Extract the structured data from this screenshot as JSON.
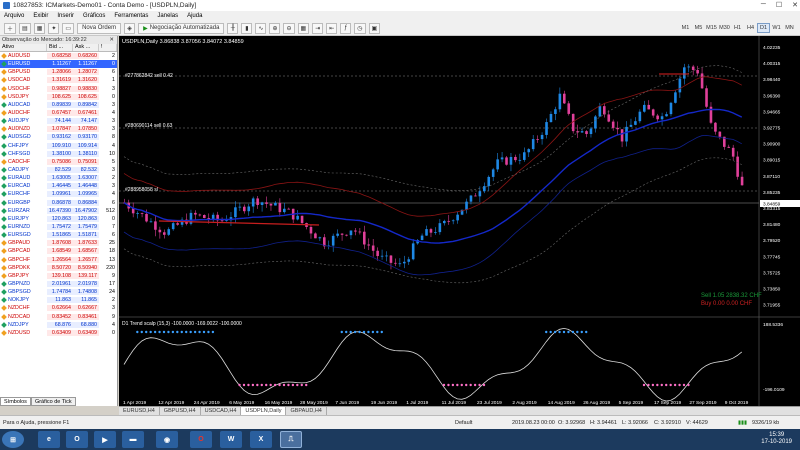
{
  "window": {
    "title": "10827853: ICMarkets-Demo01 - Conta Demo - [USDPLN,Daily]",
    "min": "─",
    "max": "☐",
    "close": "✕"
  },
  "menu": [
    "Arquivo",
    "Exibir",
    "Inserir",
    "Gráficos",
    "Ferramentas",
    "Janelas",
    "Ajuda"
  ],
  "toolbar": {
    "new_order": "Nova Ordem",
    "auto_trading": "Negociação Automatizada",
    "timeframes": [
      "M1",
      "M5",
      "M15",
      "M30",
      "H1",
      "H4",
      "D1",
      "W1",
      "MN"
    ],
    "active_timeframe": "D1"
  },
  "market_watch": {
    "title": "Observação do Mercado: 16:39:22",
    "columns": [
      "Ativo",
      "Bid ...",
      "Ask ...",
      "!"
    ],
    "rows": [
      {
        "s": "AUDUSD",
        "b": "0.68258",
        "a": "0.68260",
        "sp": "2",
        "d": "dn"
      },
      {
        "s": "EURUSD",
        "b": "1.11267",
        "a": "1.11267",
        "sp": "0",
        "d": "hl"
      },
      {
        "s": "GBPUSD",
        "b": "1.28066",
        "a": "1.28072",
        "sp": "6",
        "d": "dn"
      },
      {
        "s": "USDCAD",
        "b": "1.31619",
        "a": "1.31620",
        "sp": "1",
        "d": "dn"
      },
      {
        "s": "USDCHF",
        "b": "0.98827",
        "a": "0.98830",
        "sp": "3",
        "d": "dn"
      },
      {
        "s": "USDJPY",
        "b": "108.625",
        "a": "108.625",
        "sp": "0",
        "d": "dn"
      },
      {
        "s": "AUDCAD",
        "b": "0.89839",
        "a": "0.89842",
        "sp": "3",
        "d": "up"
      },
      {
        "s": "AUDCHF",
        "b": "0.67457",
        "a": "0.67461",
        "sp": "4",
        "d": "dn"
      },
      {
        "s": "AUDJPY",
        "b": "74.144",
        "a": "74.147",
        "sp": "3",
        "d": "up"
      },
      {
        "s": "AUDNZD",
        "b": "1.07847",
        "a": "1.07850",
        "sp": "3",
        "d": "dn"
      },
      {
        "s": "AUDSGD",
        "b": "0.93162",
        "a": "0.93170",
        "sp": "8",
        "d": "up"
      },
      {
        "s": "CHFJPY",
        "b": "109.910",
        "a": "109.914",
        "sp": "4",
        "d": "up"
      },
      {
        "s": "CHFSGD",
        "b": "1.38100",
        "a": "1.38110",
        "sp": "10",
        "d": "up"
      },
      {
        "s": "CADCHF",
        "b": "0.75086",
        "a": "0.75091",
        "sp": "5",
        "d": "dn"
      },
      {
        "s": "CADJPY",
        "b": "82.529",
        "a": "82.532",
        "sp": "3",
        "d": "up"
      },
      {
        "s": "EURAUD",
        "b": "1.63005",
        "a": "1.63007",
        "sp": "2",
        "d": "up"
      },
      {
        "s": "EURCAD",
        "b": "1.46445",
        "a": "1.46448",
        "sp": "3",
        "d": "up"
      },
      {
        "s": "EURCHF",
        "b": "1.09961",
        "a": "1.09965",
        "sp": "4",
        "d": "up"
      },
      {
        "s": "EURGBP",
        "b": "0.86878",
        "a": "0.86884",
        "sp": "6",
        "d": "up"
      },
      {
        "s": "EURZAR",
        "b": "16.47390",
        "a": "16.47902",
        "sp": "512",
        "d": "up"
      },
      {
        "s": "EURJPY",
        "b": "120.863",
        "a": "120.863",
        "sp": "0",
        "d": "up"
      },
      {
        "s": "EURNZD",
        "b": "1.75472",
        "a": "1.75479",
        "sp": "7",
        "d": "up"
      },
      {
        "s": "EURSGD",
        "b": "1.51865",
        "a": "1.51871",
        "sp": "6",
        "d": "up"
      },
      {
        "s": "GBPAUD",
        "b": "1.87608",
        "a": "1.87633",
        "sp": "25",
        "d": "dn"
      },
      {
        "s": "GBPCAD",
        "b": "1.68549",
        "a": "1.68567",
        "sp": "18",
        "d": "dn"
      },
      {
        "s": "GBPCHF",
        "b": "1.26564",
        "a": "1.26577",
        "sp": "13",
        "d": "dn"
      },
      {
        "s": "GBPDKK",
        "b": "8.50720",
        "a": "8.50940",
        "sp": "220",
        "d": "dn"
      },
      {
        "s": "GBPJPY",
        "b": "139.108",
        "a": "139.117",
        "sp": "9",
        "d": "dn"
      },
      {
        "s": "GBPNZD",
        "b": "2.01961",
        "a": "2.01978",
        "sp": "17",
        "d": "up"
      },
      {
        "s": "GBPSGD",
        "b": "1.74784",
        "a": "1.74808",
        "sp": "24",
        "d": "up"
      },
      {
        "s": "NOKJPY",
        "b": "11.863",
        "a": "11.865",
        "sp": "2",
        "d": "up"
      },
      {
        "s": "NZDCHF",
        "b": "0.62664",
        "a": "0.62667",
        "sp": "3",
        "d": "dn"
      },
      {
        "s": "NZDCAD",
        "b": "0.83452",
        "a": "0.83461",
        "sp": "9",
        "d": "dn"
      },
      {
        "s": "NZDJPY",
        "b": "68.876",
        "a": "68.880",
        "sp": "4",
        "d": "up"
      },
      {
        "s": "NZDUSD",
        "b": "0.63409",
        "a": "0.63409",
        "sp": "0",
        "d": "dn"
      }
    ],
    "tabs": [
      "Símbolos",
      "Gráfico de Tick"
    ]
  },
  "chart": {
    "header": "USDPLN,Daily  3.86838 3.87056 3.84072 3.84859",
    "line_labels": [
      "#277862842 sell 0.42",
      "#280690114 sell 0.63",
      "#288958058 sl"
    ],
    "sell_text": "Sell 1.05   2838.32 CHF",
    "buy_text": "Buy 0.00   0.00 CHF",
    "indicator_label": "D1 Trend scalp (15,3) -100.0000 -169.0022 -100.0000",
    "price_labels": [
      "4.02235",
      "4.00315",
      "3.98440",
      "3.96390",
      "3.94665",
      "3.92775",
      "3.90900",
      "3.89015",
      "3.87110",
      "3.85235",
      "3.83315",
      "3.81480",
      "3.79520",
      "3.77745",
      "3.75725",
      "3.73850",
      "3.71955"
    ],
    "current_price": "3.84859",
    "ind_labels": [
      "188.5336",
      "-196.0109"
    ],
    "dates": [
      "1 Apr 2019",
      "12 Apr 2019",
      "24 Apr 2019",
      "6 May 2019",
      "16 May 2019",
      "28 May 2019",
      "7 Jun 2019",
      "19 Jun 2019",
      "1 Jul 2019",
      "11 Jul 2019",
      "23 Jul 2019",
      "2 Aug 2019",
      "14 Aug 2019",
      "26 Aug 2019",
      "5 Sep 2019",
      "17 Sep 2019",
      "27 Sep 2019",
      "9 Oct 2019"
    ]
  },
  "chart_tabs": [
    "EURUSD,H4",
    "GBPUSD,H4",
    "USDCAD,H4",
    "USDPLN,Daily",
    "GBPAUD,H4"
  ],
  "status": {
    "help": "Para o Ajuda, pressione F1",
    "profile": "Default",
    "datetime": "2019.08.23 00:00",
    "o": "O: 3.92968",
    "h": "H: 3.94461",
    "l": "L: 3.92066",
    "c": "C: 3.92910",
    "v": "V: 44629",
    "traffic": "9326/19 kb"
  },
  "clock": {
    "time": "15:39",
    "date": "17-10-2019"
  },
  "colors": {
    "bull": "#1e88e5",
    "bear": "#e0409a",
    "ma_blue": "#1428c8",
    "ma_red": "#c81e1e"
  }
}
